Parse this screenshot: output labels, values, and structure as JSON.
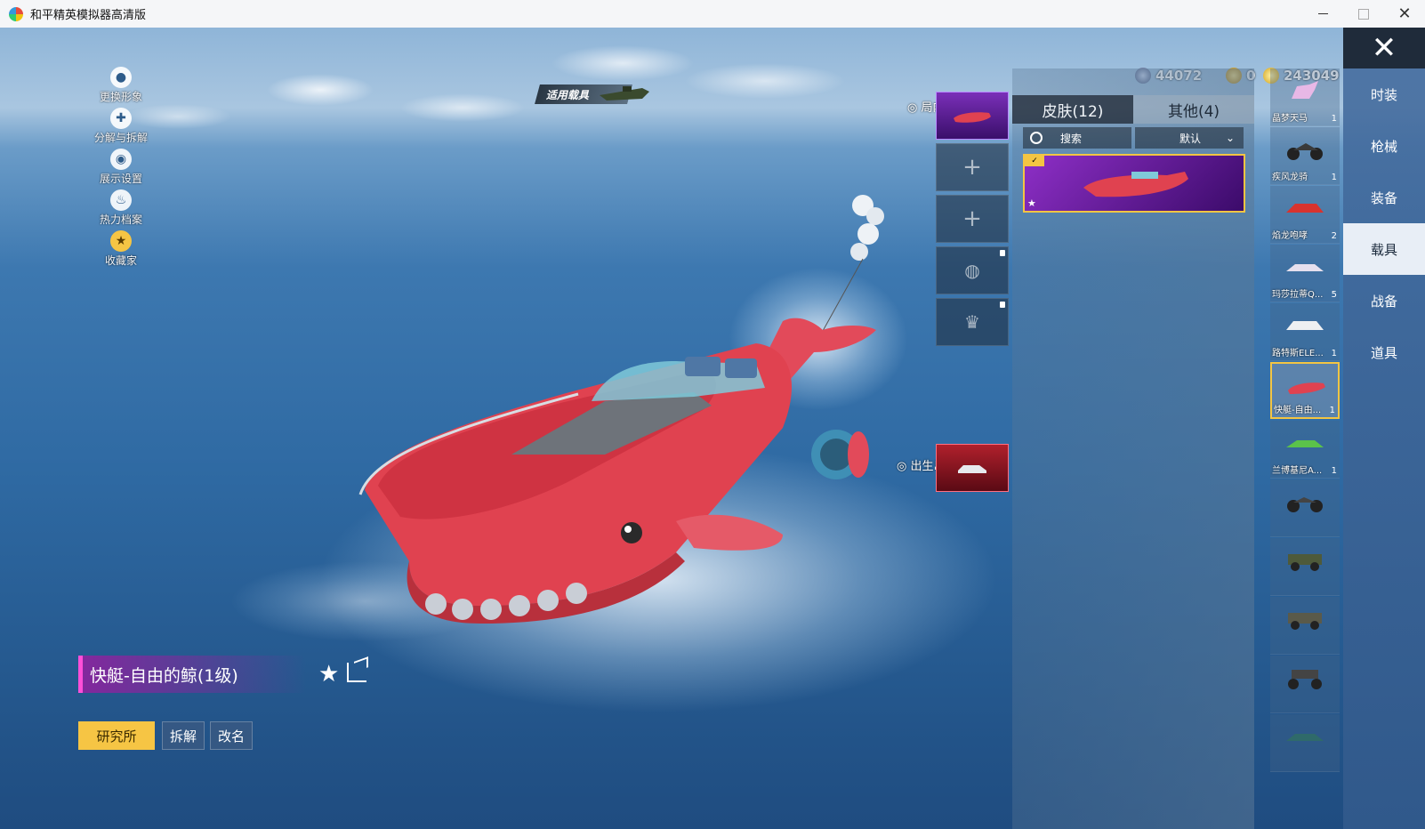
{
  "window": {
    "title": "和平精英模拟器高清版",
    "controls": {
      "minimize": "—",
      "maximize": "□",
      "close": "✕"
    }
  },
  "left_menu": [
    {
      "label": "更换形象",
      "icon": "avatar-icon"
    },
    {
      "label": "分解与拆解",
      "icon": "puzzle-icon"
    },
    {
      "label": "展示设置",
      "icon": "eye-icon"
    },
    {
      "label": "热力档案",
      "icon": "flame-icon"
    },
    {
      "label": "收藏家",
      "icon": "collector-badge-icon"
    }
  ],
  "applied_vehicle_label": "适用载具",
  "currency": [
    {
      "value": "44072",
      "icon": "gem-icon",
      "color": "#5b6b8c"
    },
    {
      "value": "0",
      "icon": "token-icon",
      "color": "#d4a017"
    },
    {
      "value": "243049",
      "icon": "coin-icon",
      "color": "#e8c23a"
    }
  ],
  "match_skin_label": "局内皮肤设置",
  "birth_island_label": "出生岛载具登场",
  "skin_panel": {
    "tabs": [
      "皮肤(12)",
      "其他(4)"
    ],
    "search_placeholder": "搜索",
    "sort_value": "默认",
    "card_badge": "✓"
  },
  "vehicles": [
    {
      "name": "晶梦天马",
      "count": "1"
    },
    {
      "name": "疾风龙骑",
      "count": "1"
    },
    {
      "name": "焰龙咆哮",
      "count": "2"
    },
    {
      "name": "玛莎拉蒂Q...",
      "count": "5"
    },
    {
      "name": "路特斯ELE...",
      "count": "1"
    },
    {
      "name": "快艇-自由...",
      "count": "1"
    },
    {
      "name": "兰博基尼A...",
      "count": "1"
    },
    {
      "name": "",
      "count": ""
    },
    {
      "name": "",
      "count": ""
    },
    {
      "name": "",
      "count": ""
    },
    {
      "name": "",
      "count": ""
    },
    {
      "name": "",
      "count": ""
    }
  ],
  "categories": [
    "时装",
    "枪械",
    "装备",
    "载具",
    "战备",
    "道具"
  ],
  "item": {
    "title": "快艇-自由的鲸(1级)"
  },
  "buttons": {
    "research": "研究所",
    "disassemble": "拆解",
    "rename": "改名"
  },
  "colors": {
    "accent_yellow": "#f6c544",
    "boat_red": "#e0404e",
    "title_magenta": "#ff4fd8"
  }
}
